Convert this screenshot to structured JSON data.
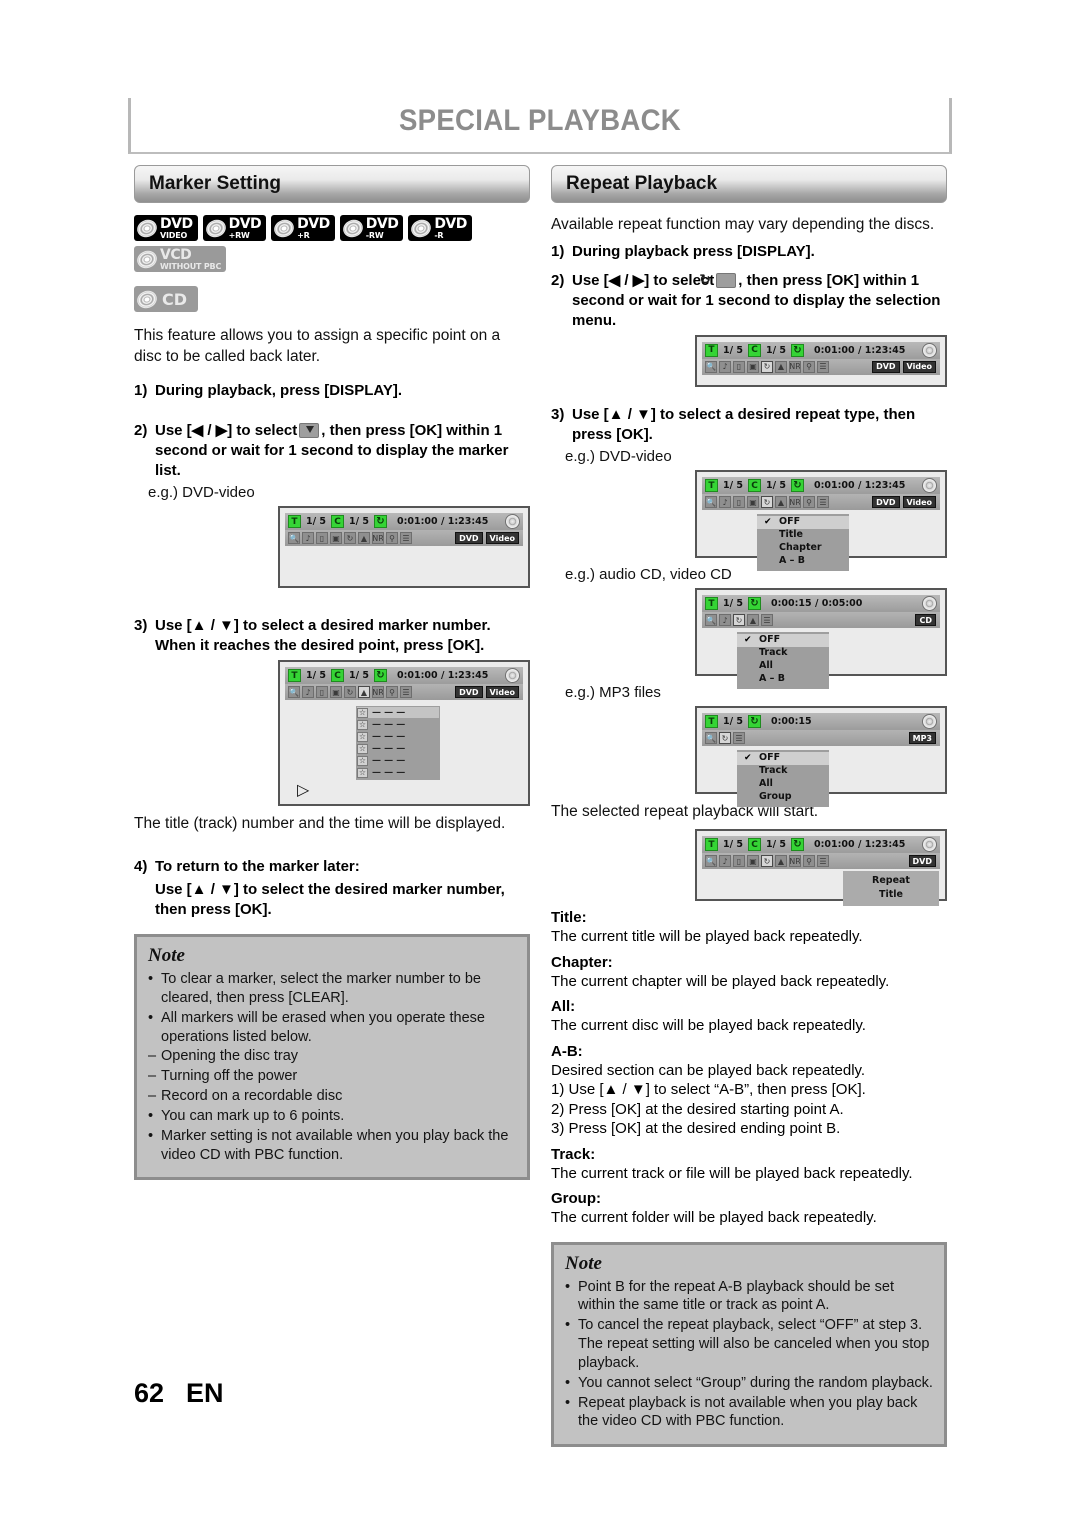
{
  "header": {
    "title": "SPECIAL PLAYBACK"
  },
  "footer": {
    "page": "62",
    "lang": "EN"
  },
  "left": {
    "section_title": "Marker Setting",
    "discs": [
      {
        "main": "DVD",
        "sub": "VIDEO",
        "style": "black"
      },
      {
        "main": "DVD",
        "sub": "+RW",
        "style": "black"
      },
      {
        "main": "DVD",
        "sub": "+R",
        "style": "black"
      },
      {
        "main": "DVD",
        "sub": "-RW",
        "style": "black"
      },
      {
        "main": "DVD",
        "sub": "-R",
        "style": "black"
      },
      {
        "main": "VCD",
        "sub": "WITHOUT PBC",
        "style": "gray"
      },
      {
        "main": "CD",
        "sub": "",
        "style": "gray"
      }
    ],
    "intro": "This feature allows you to assign a specific point on a disc to be called back later.",
    "step1_num": "1)",
    "step1": "During playback, press [DISPLAY].",
    "step2_num": "2)",
    "step2_a": "Use [◀ / ▶] to select",
    "step2_b": ", then press [OK] within 1 second or wait for 1 second to display the marker list.",
    "eg1": "e.g.) DVD-video",
    "step3_num": "3)",
    "step3": "Use [▲ / ▼] to select a desired marker number. When it reaches the desired point, press [OK].",
    "after3": "The title (track) number and the time will be displayed.",
    "step4_num": "4)",
    "step4_line1": "To return to the marker later:",
    "step4_line2": "Use [▲ / ▼] to select the desired marker number, then press [OK].",
    "note_title": "Note",
    "notes": [
      {
        "bullet": "•",
        "text": "To clear a marker, select the marker number to be cleared, then press [CLEAR]."
      },
      {
        "bullet": "•",
        "text": "All markers will be erased when you operate these operations listed below."
      },
      {
        "bullet": "–",
        "text": "Opening the disc tray"
      },
      {
        "bullet": "–",
        "text": "Turning off the power"
      },
      {
        "bullet": "–",
        "text": "Record on a recordable disc"
      },
      {
        "bullet": "•",
        "text": "You can mark up to 6 points."
      },
      {
        "bullet": "•",
        "text": "Marker setting is not available when you play back the video CD with PBC function."
      }
    ]
  },
  "right": {
    "section_title": "Repeat Playback",
    "intro": "Available repeat function may vary depending the discs.",
    "step1_num": "1)",
    "step1": "During playback press [DISPLAY].",
    "step2_num": "2)",
    "step2_a": "Use [◀ / ▶] to select",
    "step2_b": ", then press [OK] within 1 second or wait for 1 second to display the selection menu.",
    "step3_num": "3)",
    "step3": "Use [▲ / ▼] to select a desired repeat type, then press [OK].",
    "eg_dvd": "e.g.) DVD-video",
    "eg_cd": "e.g.) audio CD, video CD",
    "eg_mp3": "e.g.) MP3 files",
    "after": "The selected repeat playback will start.",
    "definitions": [
      {
        "term": "Title:",
        "desc": "The current title will be played back repeatedly."
      },
      {
        "term": "Chapter:",
        "desc": "The current chapter will be played back repeatedly."
      },
      {
        "term": "All:",
        "desc": "The current disc will be played back repeatedly."
      },
      {
        "term": "A-B:",
        "desc": "Desired section can be played back repeatedly."
      },
      {
        "term": "Track:",
        "desc": "The current track or file will be played back repeatedly."
      },
      {
        "term": "Group:",
        "desc": "The current folder will be played back repeatedly."
      }
    ],
    "ab_steps": [
      "1) Use [▲ / ▼] to select “A-B”, then press [OK].",
      "2) Press [OK] at the desired starting point A.",
      "3) Press [OK] at the desired ending point B."
    ],
    "note_title": "Note",
    "notes": [
      {
        "bullet": "•",
        "text": "Point B for the repeat A-B playback should be set within the same title or track as point A."
      },
      {
        "bullet": "•",
        "text": "To cancel the repeat playback, select “OFF” at step 3. The repeat setting will also be canceled when you stop playback."
      },
      {
        "bullet": "•",
        "text": "You cannot select “Group” during the random playback."
      },
      {
        "bullet": "•",
        "text": "Repeat playback is not available when you play back the video CD with PBC function."
      }
    ]
  },
  "osd": {
    "dvd": {
      "t_label": "T",
      "t_value": "1/  5",
      "c_label": "C",
      "c_value": "1/  5",
      "time": "0:01:00 / 1:23:45",
      "tags": [
        "DVD",
        "Video"
      ]
    },
    "cd": {
      "t_label": "T",
      "t_value": "1/  5",
      "time": "0:00:15 / 0:05:00",
      "tags": [
        "CD"
      ]
    },
    "mp3": {
      "t_label": "T",
      "t_value": "1/  5",
      "time": "0:00:15",
      "tags": [
        "MP3"
      ]
    },
    "dvd_repeat": {
      "t_label": "T",
      "t_value": "1/  5",
      "c_label": "C",
      "c_value": "1/  5",
      "time": "0:01:00 / 1:23:45",
      "tags": [
        "DVD"
      ],
      "status_line1": "Repeat",
      "status_line2": "Title"
    },
    "marker_dashes": "— — —",
    "marker_star": "☆",
    "menu_dvd": {
      "check": "✔",
      "items": [
        "OFF",
        "Title",
        "Chapter",
        "A – B"
      ]
    },
    "menu_cd": {
      "check": "✔",
      "items": [
        "OFF",
        "Track",
        "All",
        "A – B"
      ]
    },
    "menu_mp3": {
      "check": "✔",
      "items": [
        "OFF",
        "Track",
        "All",
        "Group"
      ]
    }
  }
}
